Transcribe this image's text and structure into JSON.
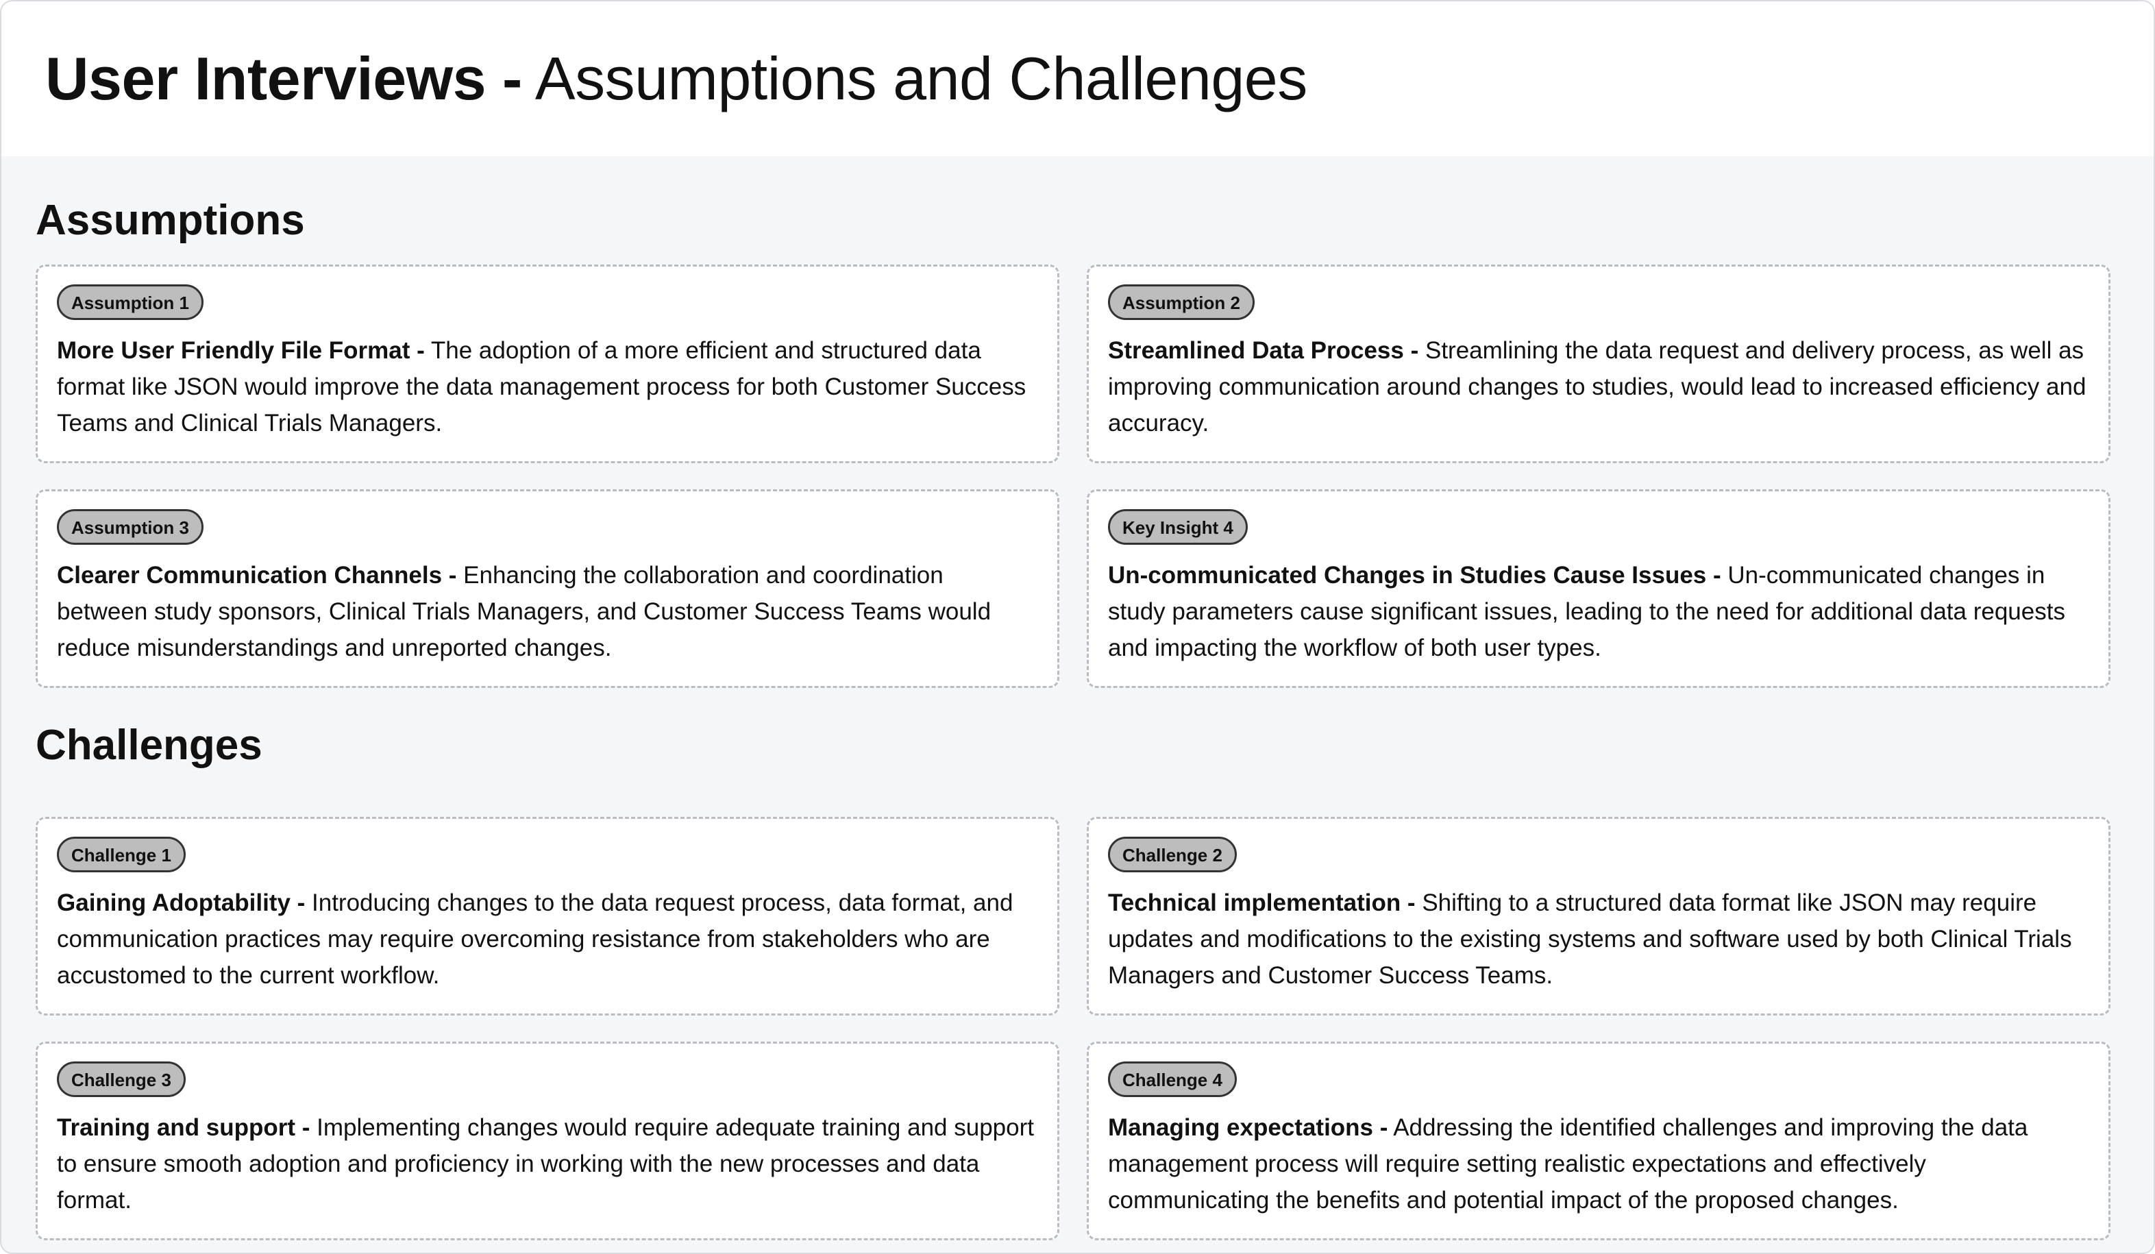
{
  "header": {
    "title_bold": "User Interviews -",
    "title_regular": " Assumptions and Challenges"
  },
  "assumptions": {
    "title": "Assumptions",
    "cards": [
      {
        "badge": "Assumption 1",
        "heading": "More User Friendly File Format -",
        "text": " The adoption of a more efficient and structured data format like JSON would improve the data management process for both Customer Success Teams and Clinical Trials Managers."
      },
      {
        "badge": "Assumption 2",
        "heading": "Streamlined Data Process -",
        "text": " Streamlining the data request and delivery process, as well as improving communication around changes to studies, would lead to increased efficiency and accuracy."
      },
      {
        "badge": "Assumption 3",
        "heading": "Clearer Communication Channels -",
        "text": " Enhancing the collaboration and coordination between study sponsors, Clinical Trials Managers, and Customer Success Teams would reduce misunderstandings and unreported changes."
      },
      {
        "badge": "Key Insight 4",
        "heading": "Un-communicated Changes in Studies Cause Issues -",
        "text": " Un-communicated changes in study parameters cause significant issues, leading to the need for additional data requests and impacting the workflow of both user types."
      }
    ]
  },
  "challenges": {
    "title": "Challenges",
    "cards": [
      {
        "badge": "Challenge 1",
        "heading": "Gaining Adoptability -",
        "text": " Introducing changes to the data request process, data format, and communication practices may require overcoming resistance from stakeholders who are accustomed to the current workflow."
      },
      {
        "badge": "Challenge 2",
        "heading": "Technical implementation -",
        "text": " Shifting to a structured data format like JSON may require updates and modifications to the existing systems and software used by both Clinical Trials Managers and Customer Success Teams."
      },
      {
        "badge": "Challenge 3",
        "heading": "Training and support -",
        "text": " Implementing changes would require adequate training and support to ensure smooth adoption and proficiency in working with the new processes and data format."
      },
      {
        "badge": "Challenge 4",
        "heading": "Managing expectations -",
        "text": " Addressing the identified challenges and improving the data management process will require setting realistic expectations and effectively communicating the benefits and potential impact of the proposed changes."
      }
    ]
  }
}
